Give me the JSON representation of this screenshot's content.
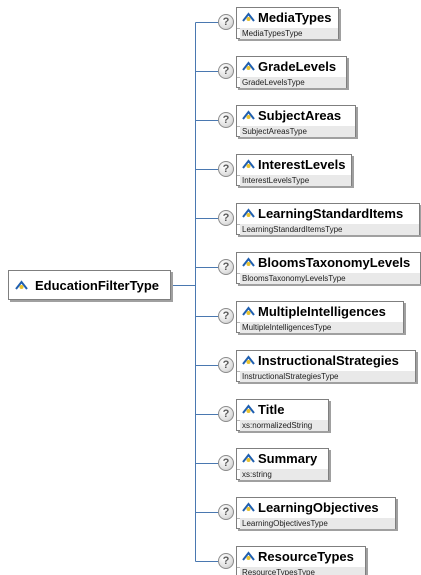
{
  "root": {
    "name": "EducationFilterType"
  },
  "help_glyph": "?",
  "children": [
    {
      "name": "MediaTypes",
      "type": "MediaTypesType"
    },
    {
      "name": "GradeLevels",
      "type": "GradeLevelsType"
    },
    {
      "name": "SubjectAreas",
      "type": "SubjectAreasType"
    },
    {
      "name": "InterestLevels",
      "type": "InterestLevelsType"
    },
    {
      "name": "LearningStandardItems",
      "type": "LearningStandardItemsType"
    },
    {
      "name": "BloomsTaxonomyLevels",
      "type": "BloomsTaxonomyLevelsType"
    },
    {
      "name": "MultipleIntelligences",
      "type": "MultipleIntelligencesType"
    },
    {
      "name": "InstructionalStrategies",
      "type": "InstructionalStrategiesType"
    },
    {
      "name": "Title",
      "type": "xs:normalizedString"
    },
    {
      "name": "Summary",
      "type": "xs:string"
    },
    {
      "name": "LearningObjectives",
      "type": "LearningObjectivesType"
    },
    {
      "name": "ResourceTypes",
      "type": "ResourceTypesType"
    }
  ],
  "colors": {
    "connector": "#4a78b0",
    "icon_blue": "#1f5fb0",
    "icon_yellow": "#e8c22e",
    "border": "#7f7f7f"
  }
}
